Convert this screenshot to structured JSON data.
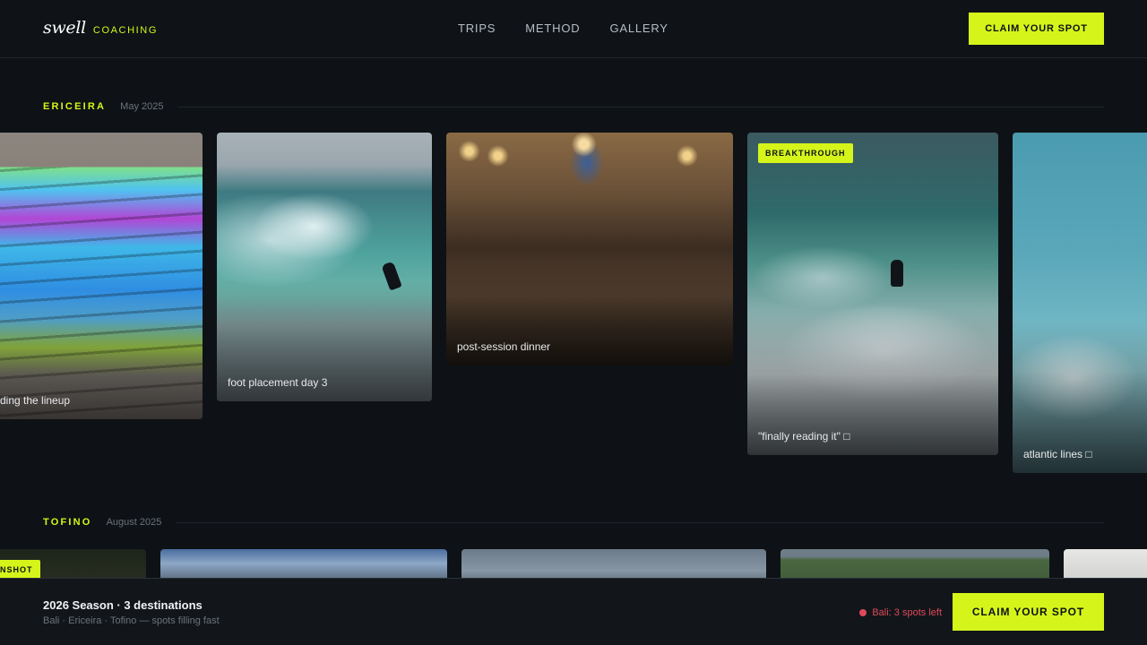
{
  "header": {
    "logo_word": "swell",
    "logo_sub": "COACHING",
    "nav": [
      "TRIPS",
      "METHOD",
      "GALLERY"
    ],
    "cta": "CLAIM YOUR SPOT"
  },
  "sections": [
    {
      "name": "ERICEIRA",
      "date": "May 2025",
      "cards": [
        {
          "caption": "ding the lineup"
        },
        {
          "caption": "foot placement day 3"
        },
        {
          "caption": "post-session dinner"
        },
        {
          "caption": "\"finally reading it\" □",
          "badge": "BREAKTHROUGH"
        },
        {
          "caption": "atlantic lines □"
        }
      ]
    },
    {
      "name": "TOFINO",
      "date": "August 2025",
      "cards": [
        {
          "badge": "NSHOT"
        }
      ]
    }
  ],
  "bottom_bar": {
    "title": "2026 Season · 3 destinations",
    "subtitle": "Bali · Ericeira · Tofino — spots filling fast",
    "spots_status": "Bali: 3 spots left",
    "cta": "CLAIM YOUR SPOT"
  },
  "colors": {
    "accent": "#d5f51a",
    "background": "#0e1216",
    "alert": "#e0485a"
  }
}
